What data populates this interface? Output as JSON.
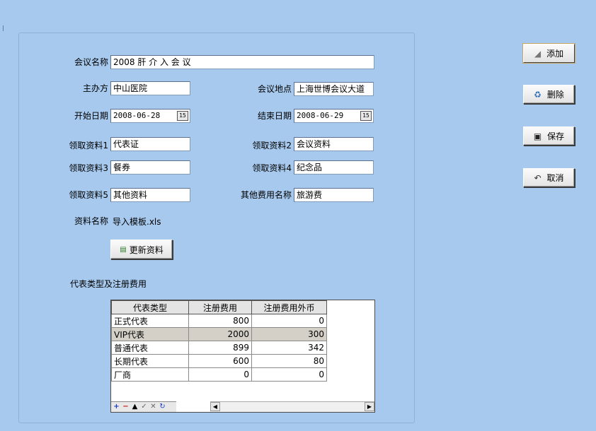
{
  "form": {
    "meeting_name_label": "会议名称",
    "meeting_name_value": "2008 肝 介 入 会 议",
    "host_label": "主办方",
    "host_value": "中山医院",
    "location_label": "会议地点",
    "location_value": "上海世博会议大道",
    "start_date_label": "开始日期",
    "start_date_value": "2008-06-28",
    "end_date_label": "结束日期",
    "end_date_value": "2008-06-29",
    "material1_label": "领取资料1",
    "material1_value": "代表证",
    "material2_label": "领取资料2",
    "material2_value": "会议资料",
    "material3_label": "领取资料3",
    "material3_value": "餐券",
    "material4_label": "领取资料4",
    "material4_value": "纪念品",
    "material5_label": "领取资料5",
    "material5_value": "其他资料",
    "other_fee_label": "其他费用名称",
    "other_fee_value": "旅游费",
    "doc_name_label": "资料名称",
    "doc_name_value": "导入模板.xls",
    "update_button": "更新资料",
    "calendar_icon_text": "15",
    "grid_title": "代表类型及注册费用"
  },
  "grid": {
    "headers": [
      "代表类型",
      "注册费用",
      "注册费用外币"
    ],
    "rows": [
      {
        "type": "正式代表",
        "fee": "800",
        "fee_fx": "0"
      },
      {
        "type": "VIP代表",
        "fee": "2000",
        "fee_fx": "300"
      },
      {
        "type": "普通代表",
        "fee": "899",
        "fee_fx": "342"
      },
      {
        "type": "长期代表",
        "fee": "600",
        "fee_fx": "80"
      },
      {
        "type": "厂商",
        "fee": "0",
        "fee_fx": "0"
      }
    ],
    "selected_row": 1
  },
  "actions": {
    "add": "添加",
    "delete": "删除",
    "save": "保存",
    "cancel": "取消"
  },
  "icons": {
    "add": "page-icon",
    "delete": "recycle-icon",
    "save": "floppy-disk-icon",
    "cancel": "undo-icon",
    "update": "spreadsheet-icon",
    "calendar": "calendar-icon"
  },
  "colors": {
    "background": "#a7c9ee",
    "grid_selected": "#d4d0c8"
  }
}
